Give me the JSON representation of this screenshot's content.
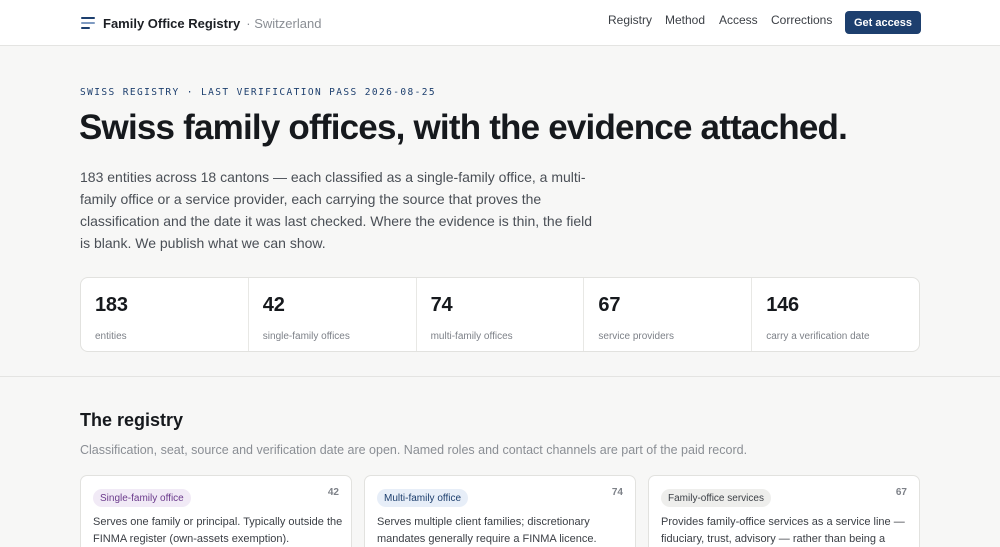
{
  "header": {
    "brand": "Family Office Registry",
    "region": "· Switzerland",
    "nav": [
      {
        "label": "Registry"
      },
      {
        "label": "Method"
      },
      {
        "label": "Access"
      },
      {
        "label": "Corrections"
      }
    ],
    "cta_label": "Get access",
    "accent_color": "#1d3f6e"
  },
  "hero": {
    "eyebrow": "SWISS REGISTRY · LAST VERIFICATION PASS 2026-08-25",
    "title": "Swiss family offices, with the evidence attached.",
    "lede": "183 entities across 18 cantons — each classified as a single-family office, a multi-family office or a service provider, each carrying the source that proves the classification and the date it was last checked. Where the evidence is thin, the field is blank. We publish what we can show."
  },
  "stats": [
    {
      "value": "183",
      "label": "entities"
    },
    {
      "value": "42",
      "label": "single-family offices"
    },
    {
      "value": "74",
      "label": "multi-family offices"
    },
    {
      "value": "67",
      "label": "service providers"
    },
    {
      "value": "146",
      "label": "carry a verification date"
    }
  ],
  "registry": {
    "title": "The registry",
    "subtitle": "Classification, seat, source and verification date are open. Named roles and contact channels are part of the paid record.",
    "cards": [
      {
        "tag": "Single-family office",
        "count": "42",
        "description": "Serves one family or principal. Typically outside the FINMA register (own-assets exemption).",
        "tag_bg": "#f1eaf6",
        "tag_color": "#6b3a8c"
      },
      {
        "tag": "Multi-family office",
        "count": "74",
        "description": "Serves multiple client families; discretionary mandates generally require a FINMA licence.",
        "tag_bg": "#e7eef8",
        "tag_color": "#1d3f6e"
      },
      {
        "tag": "Family-office services",
        "count": "67",
        "description": "Provides family-office services as a service line — fiduciary, trust, advisory — rather than being a",
        "tag_bg": "#eeeeec",
        "tag_color": "#3b3f45"
      }
    ]
  }
}
